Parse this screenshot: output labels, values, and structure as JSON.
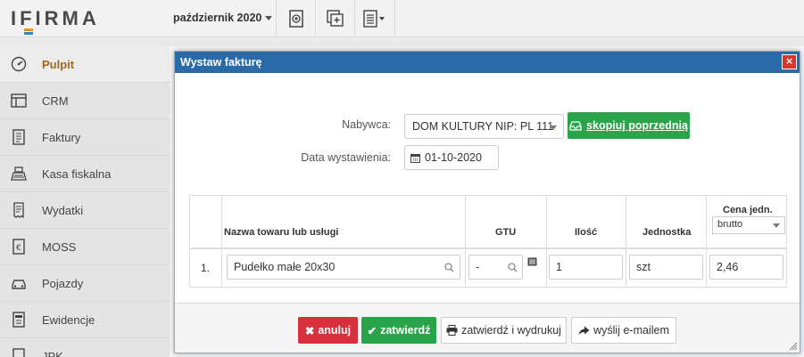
{
  "app": {
    "logo": "IFIRMA"
  },
  "header": {
    "month": "październik 2020"
  },
  "sidebar": {
    "items": [
      {
        "label": "Pulpit",
        "icon": "dashboard-icon",
        "active": true
      },
      {
        "label": "CRM",
        "icon": "layout-icon"
      },
      {
        "label": "Faktury",
        "icon": "document-icon"
      },
      {
        "label": "Kasa fiskalna",
        "icon": "cash-register-icon"
      },
      {
        "label": "Wydatki",
        "icon": "receipt-icon"
      },
      {
        "label": "MOSS",
        "icon": "euro-document-icon"
      },
      {
        "label": "Pojazdy",
        "icon": "car-icon"
      },
      {
        "label": "Ewidencje",
        "icon": "ledger-icon"
      },
      {
        "label": "JPK",
        "icon": "jpk-icon"
      }
    ]
  },
  "modal": {
    "title": "Wystaw fakturę",
    "close_label": "×",
    "buyer_label": "Nabywca:",
    "buyer_value": "DOM KULTURY NIP: PL 111",
    "copy_button": "skopiuj poprzednią",
    "date_label": "Data wystawienia:",
    "date_value": "01-10-2020",
    "table": {
      "headers": {
        "name": "Nazwa towaru lub usługi",
        "gtu": "GTU",
        "qty": "Ilość",
        "unit": "Jednostka",
        "price": "Cena jedn."
      },
      "price_type": "brutto",
      "row": {
        "num": "1.",
        "name": "Pudełko małe 20x30",
        "gtu": "-",
        "qty": "1",
        "unit": "szt",
        "price": "2,46"
      }
    },
    "buttons": {
      "cancel": "anuluj",
      "confirm": "zatwierdź",
      "confirm_print": "zatwierdź i wydrukuj",
      "send_email": "wyślij e-mailem"
    }
  },
  "colors": {
    "modal_header": "#2a6aa8",
    "green": "#2aa44a",
    "red": "#d7303c",
    "active_nav": "#a0661f"
  }
}
